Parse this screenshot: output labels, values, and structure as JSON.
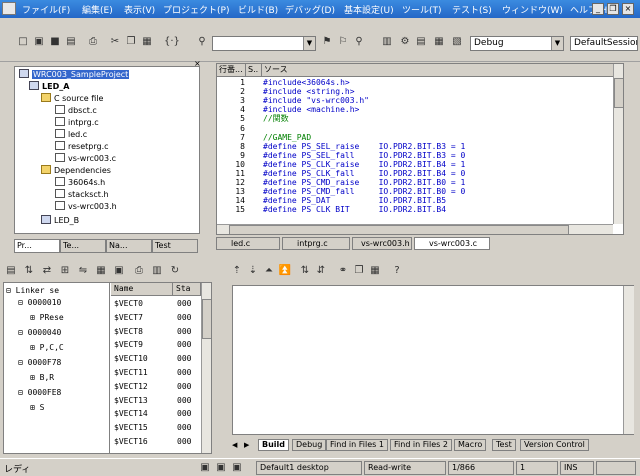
{
  "menubar": {
    "items": [
      "ファイル(F)",
      "編集(E)",
      "表示(V)",
      "プロジェクト(P)",
      "ビルド(B)",
      "デバッグ(D)",
      "基本設定(U)",
      "ツール(T)",
      "テスト(S)",
      "ウィンドウ(W)",
      "ヘルプ(H)"
    ],
    "controls": [
      "_",
      "❐",
      "×"
    ]
  },
  "toolbar": {
    "config_combo": "Debug",
    "session_combo": "DefaultSession"
  },
  "workspace": {
    "tree": {
      "project": "WRC003_SampleProject",
      "subproject_a": "LED_A",
      "c_source_folder": "C source file",
      "c_files": [
        "dbsct.c",
        "intprg.c",
        "led.c",
        "resetprg.c",
        "vs-wrc003.c"
      ],
      "deps_folder": "Dependencies",
      "dep_files": [
        "36064s.h",
        "stacksct.h",
        "vs-wrc003.h"
      ],
      "subproject_b": "LED_B"
    },
    "tabs": [
      "Pr...",
      "Te...",
      "Na...",
      "Test"
    ]
  },
  "editor": {
    "headers": {
      "line": "行番...",
      "s": "S..",
      "source": "ソース"
    },
    "lines": [
      {
        "n": "1",
        "t": "#include<36064s.h>",
        "k": "pp"
      },
      {
        "n": "2",
        "t": "#include <string.h>",
        "k": "pp"
      },
      {
        "n": "3",
        "t": "#include \"vs-wrc003.h\"",
        "k": "pp"
      },
      {
        "n": "4",
        "t": "#include <machine.h>",
        "k": "pp"
      },
      {
        "n": "5",
        "t": "//関数",
        "k": "cmt"
      },
      {
        "n": "6",
        "t": "",
        "k": ""
      },
      {
        "n": "7",
        "t": "//GAME_PAD",
        "k": "cmt"
      },
      {
        "n": "8",
        "t": "#define PS_SEL_raise    IO.PDR2.BIT.B3 = 1",
        "k": "pp"
      },
      {
        "n": "9",
        "t": "#define PS_SEL_fall     IO.PDR2.BIT.B3 = 0",
        "k": "pp"
      },
      {
        "n": "10",
        "t": "#define PS_CLK_raise    IO.PDR2.BIT.B4 = 1",
        "k": "pp"
      },
      {
        "n": "11",
        "t": "#define PS_CLK_fall     IO.PDR2.BIT.B4 = 0",
        "k": "pp"
      },
      {
        "n": "12",
        "t": "#define PS_CMD_raise    IO.PDR2.BIT.B0 = 1",
        "k": "pp"
      },
      {
        "n": "13",
        "t": "#define PS_CMD_fall     IO.PDR2.BIT.B0 = 0",
        "k": "pp"
      },
      {
        "n": "14",
        "t": "#define PS_DAT          IO.PDR7.BIT.B5",
        "k": "pp"
      },
      {
        "n": "15",
        "t": "#define PS CLK BIT      IO.PDR2.BIT.B4",
        "k": "pp"
      }
    ],
    "tabs": [
      "led.c",
      "intprg.c",
      "vs-wrc003.h",
      "vs-wrc003.c"
    ]
  },
  "symbols": {
    "tree": [
      "Linker se",
      "0000010",
      "PRese",
      "0000040",
      "P,C,C",
      "0000F78",
      "B,R",
      "0000FE8",
      "S"
    ],
    "headers": [
      "Name",
      "Sta"
    ],
    "names": [
      "$VECT0",
      "$VECT7",
      "$VECT8",
      "$VECT9",
      "$VECT10",
      "$VECT11",
      "$VECT12",
      "$VECT13",
      "$VECT14",
      "$VECT15",
      "$VECT16"
    ],
    "starts": [
      "000",
      "000",
      "000",
      "000",
      "000",
      "000",
      "000",
      "000",
      "000",
      "000",
      "000"
    ]
  },
  "output": {
    "tabs": [
      "Build",
      "Debug",
      "Find in Files 1",
      "Find in Files 2",
      "Macro",
      "Test",
      "Version Control"
    ]
  },
  "statusbar": {
    "ready": "レディ",
    "desktop": "Default1 desktop",
    "mode": "Read-write",
    "lines": "1/866",
    "col": "1",
    "ins": "INS"
  }
}
